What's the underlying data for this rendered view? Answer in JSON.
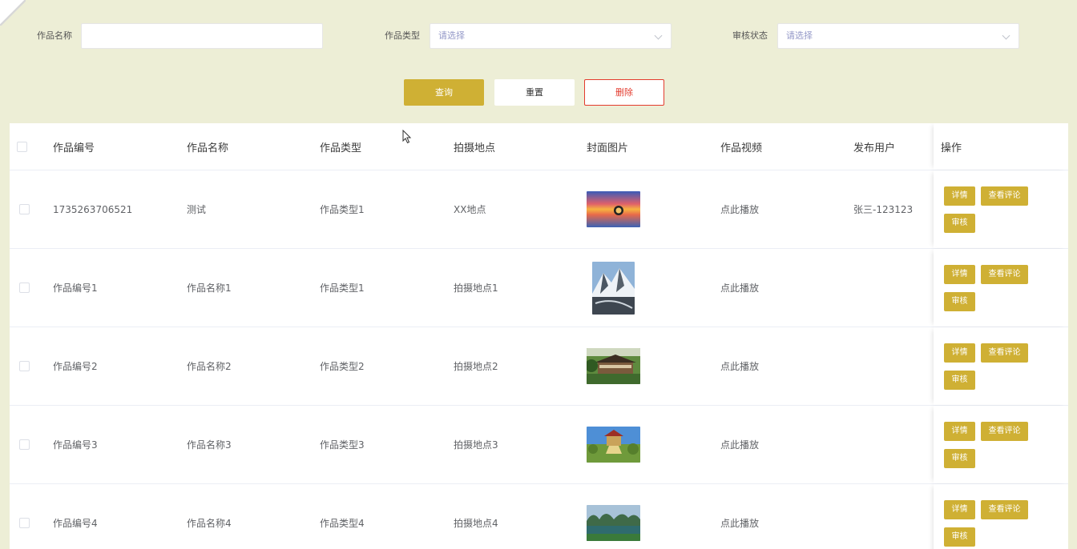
{
  "filters": {
    "name_label": "作品名称",
    "name_value": "",
    "type_label": "作品类型",
    "type_placeholder": "请选择",
    "status_label": "审核状态",
    "status_placeholder": "请选择"
  },
  "actions": {
    "query": "查询",
    "reset": "重置",
    "delete": "删除"
  },
  "table": {
    "headers": [
      "作品编号",
      "作品名称",
      "作品类型",
      "拍摄地点",
      "封面图片",
      "作品视频",
      "发布用户",
      "操作"
    ],
    "row_buttons": {
      "detail": "详情",
      "comments": "查看评论",
      "audit": "审核"
    },
    "rows": [
      {
        "id": "1735263706521",
        "name": "测试",
        "type": "作品类型1",
        "location": "XX地点",
        "video": "点此播放",
        "user": "张三-123123",
        "cover": "sunset"
      },
      {
        "id": "作品编号1",
        "name": "作品名称1",
        "type": "作品类型1",
        "location": "拍摄地点1",
        "video": "点此播放",
        "user": "",
        "cover": "snow-mountain"
      },
      {
        "id": "作品编号2",
        "name": "作品名称2",
        "type": "作品类型2",
        "location": "拍摄地点2",
        "video": "点此播放",
        "user": "",
        "cover": "temple"
      },
      {
        "id": "作品编号3",
        "name": "作品名称3",
        "type": "作品类型3",
        "location": "拍摄地点3",
        "video": "点此播放",
        "user": "",
        "cover": "pavilion"
      },
      {
        "id": "作品编号4",
        "name": "作品名称4",
        "type": "作品类型4",
        "location": "拍摄地点4",
        "video": "点此播放",
        "user": "",
        "cover": "karst-lake"
      }
    ]
  },
  "colors": {
    "background": "#edeed6",
    "accent": "#cfb034",
    "danger": "#e33b2e",
    "placeholder": "#9499c8"
  }
}
